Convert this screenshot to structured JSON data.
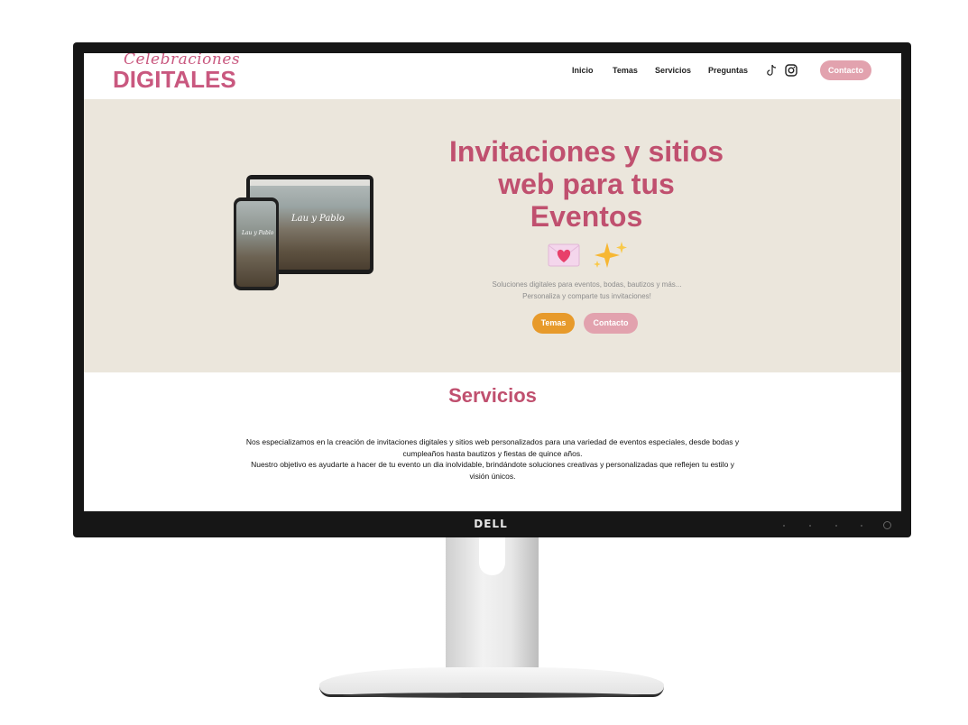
{
  "monitor": {
    "brand": "DELL"
  },
  "site": {
    "logo_script": "Celebraciones",
    "logo_main": "DIGITALES",
    "nav": {
      "links": [
        "Inicio",
        "Temas",
        "Servicios",
        "Preguntas"
      ],
      "social_icons": [
        "tiktok-icon",
        "instagram-icon"
      ],
      "contact_label": "Contacto"
    },
    "hero": {
      "title_line1": "Invitaciones y sitios",
      "title_line2": "web para tus",
      "title_line3": "Eventos",
      "emojis": [
        "love-letter-icon",
        "sparkles-icon"
      ],
      "subtitle_line1": "Soluciones digitales para eventos, bodas, bautizos y más...",
      "subtitle_line2": "Personaliza y comparte tus invitaciones!",
      "btn_temas": "Temas",
      "btn_contacto": "Contacto",
      "mockup_script": "Lau y Pablo"
    },
    "services": {
      "title": "Servicios",
      "line1": "Nos especializamos en la creación de invitaciones digitales y sitios web personalizados para una variedad de eventos especiales, desde bodas y",
      "line2": "cumpleaños hasta bautizos y fiestas de quince años.",
      "line3": "Nuestro objetivo es ayudarte a hacer de tu evento un dia inolvidable, brindándote soluciones creativas y personalizadas que reflejen tu estilo y",
      "line4": "visión únicos."
    },
    "colors": {
      "brand_pink": "#c0506f",
      "button_pink": "#e2a2ae",
      "button_orange": "#e79a2b",
      "hero_bg": "#ebe6dc"
    }
  }
}
